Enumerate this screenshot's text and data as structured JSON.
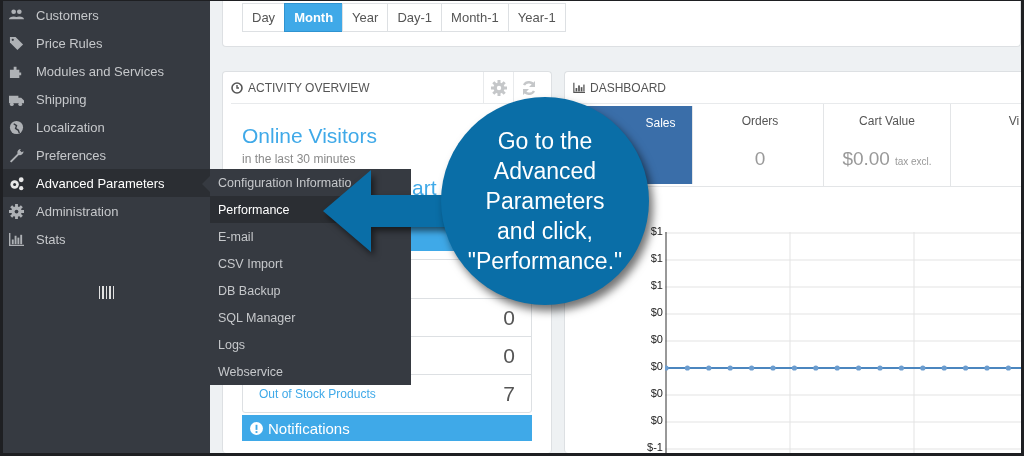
{
  "sidebar": {
    "items": [
      {
        "label": "Customers",
        "selected": false
      },
      {
        "label": "Price Rules",
        "selected": false
      },
      {
        "label": "Modules and Services",
        "selected": false
      },
      {
        "label": "Shipping",
        "selected": false
      },
      {
        "label": "Localization",
        "selected": false
      },
      {
        "label": "Preferences",
        "selected": false
      },
      {
        "label": "Advanced Parameters",
        "selected": true
      },
      {
        "label": "Administration",
        "selected": false
      },
      {
        "label": "Stats",
        "selected": false
      }
    ]
  },
  "submenu": {
    "items": [
      {
        "label": "Configuration Informatio",
        "selected": false
      },
      {
        "label": "Performance",
        "selected": true
      },
      {
        "label": "E-mail",
        "selected": false
      },
      {
        "label": "CSV Import",
        "selected": false
      },
      {
        "label": "DB Backup",
        "selected": false
      },
      {
        "label": "SQL Manager",
        "selected": false
      },
      {
        "label": "Logs",
        "selected": false
      },
      {
        "label": "Webservice",
        "selected": false
      }
    ]
  },
  "period_tabs": [
    {
      "label": "Day",
      "selected": false
    },
    {
      "label": "Month",
      "selected": true
    },
    {
      "label": "Year",
      "selected": false
    },
    {
      "label": "Day-1",
      "selected": false
    },
    {
      "label": "Month-1",
      "selected": false
    },
    {
      "label": "Year-1",
      "selected": false
    }
  ],
  "activity_overview": {
    "title": "ACTIVITY OVERVIEW",
    "visitors_title": "Online Visitors",
    "visitors_subtitle": "in the last 30 minutes",
    "carts_title_fragment": "art",
    "rows": [
      {
        "value": "0"
      },
      {
        "value": "0"
      },
      {
        "label": "Out of Stock Products",
        "value": "7"
      }
    ],
    "notifications_title": "Notifications"
  },
  "dashboard": {
    "title": "DASHBOARD",
    "tiles": [
      {
        "label": "Sales",
        "selected": true
      },
      {
        "label": "Orders",
        "value": "0",
        "selected": false
      },
      {
        "label": "Cart Value",
        "value": "$0.00",
        "note": "tax excl.",
        "selected": false
      },
      {
        "label": "Vi",
        "selected": false
      }
    ],
    "y_axis_labels": [
      "$1",
      "$1",
      "$1",
      "$0",
      "$0",
      "$0",
      "$0",
      "$0",
      "$-1"
    ]
  },
  "callout": {
    "text": "Go to the\nAdvanced\nParameters\nand click,\n\"Performance.\""
  }
}
